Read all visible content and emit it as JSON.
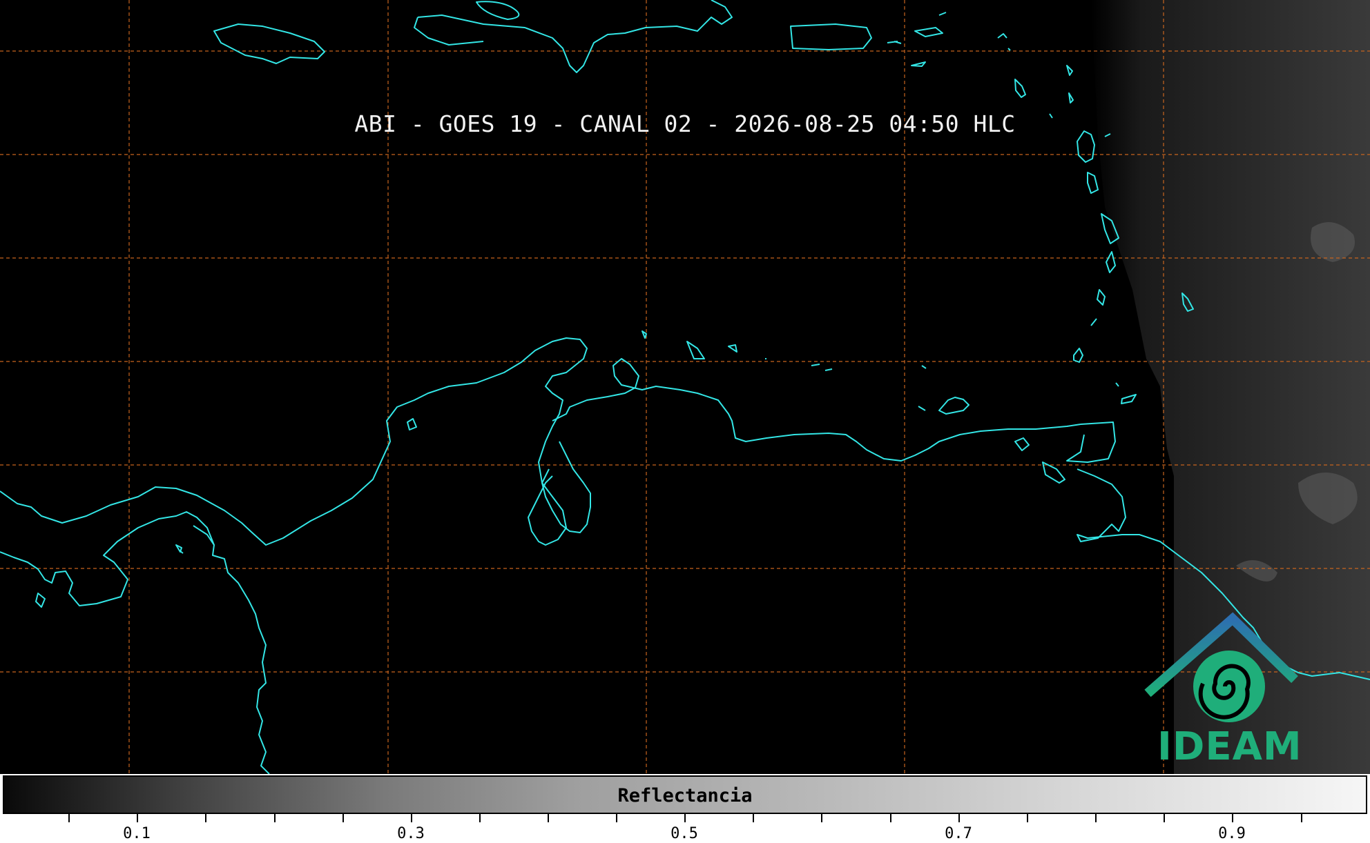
{
  "title": "ABI - GOES 19 - CANAL 02 - 2026-08-25 04:50 HLC",
  "colorbar": {
    "label": "Reflectancia",
    "tick_labels": [
      "0.1",
      "0.3",
      "0.5",
      "0.7",
      "0.9"
    ]
  },
  "logo": {
    "text": "IDEAM"
  },
  "colors": {
    "coastline": "#33e6e6",
    "gridline": "#c8641e",
    "background": "#000000",
    "logo_blue": "#2d6fb0",
    "logo_green": "#1fae7a"
  }
}
